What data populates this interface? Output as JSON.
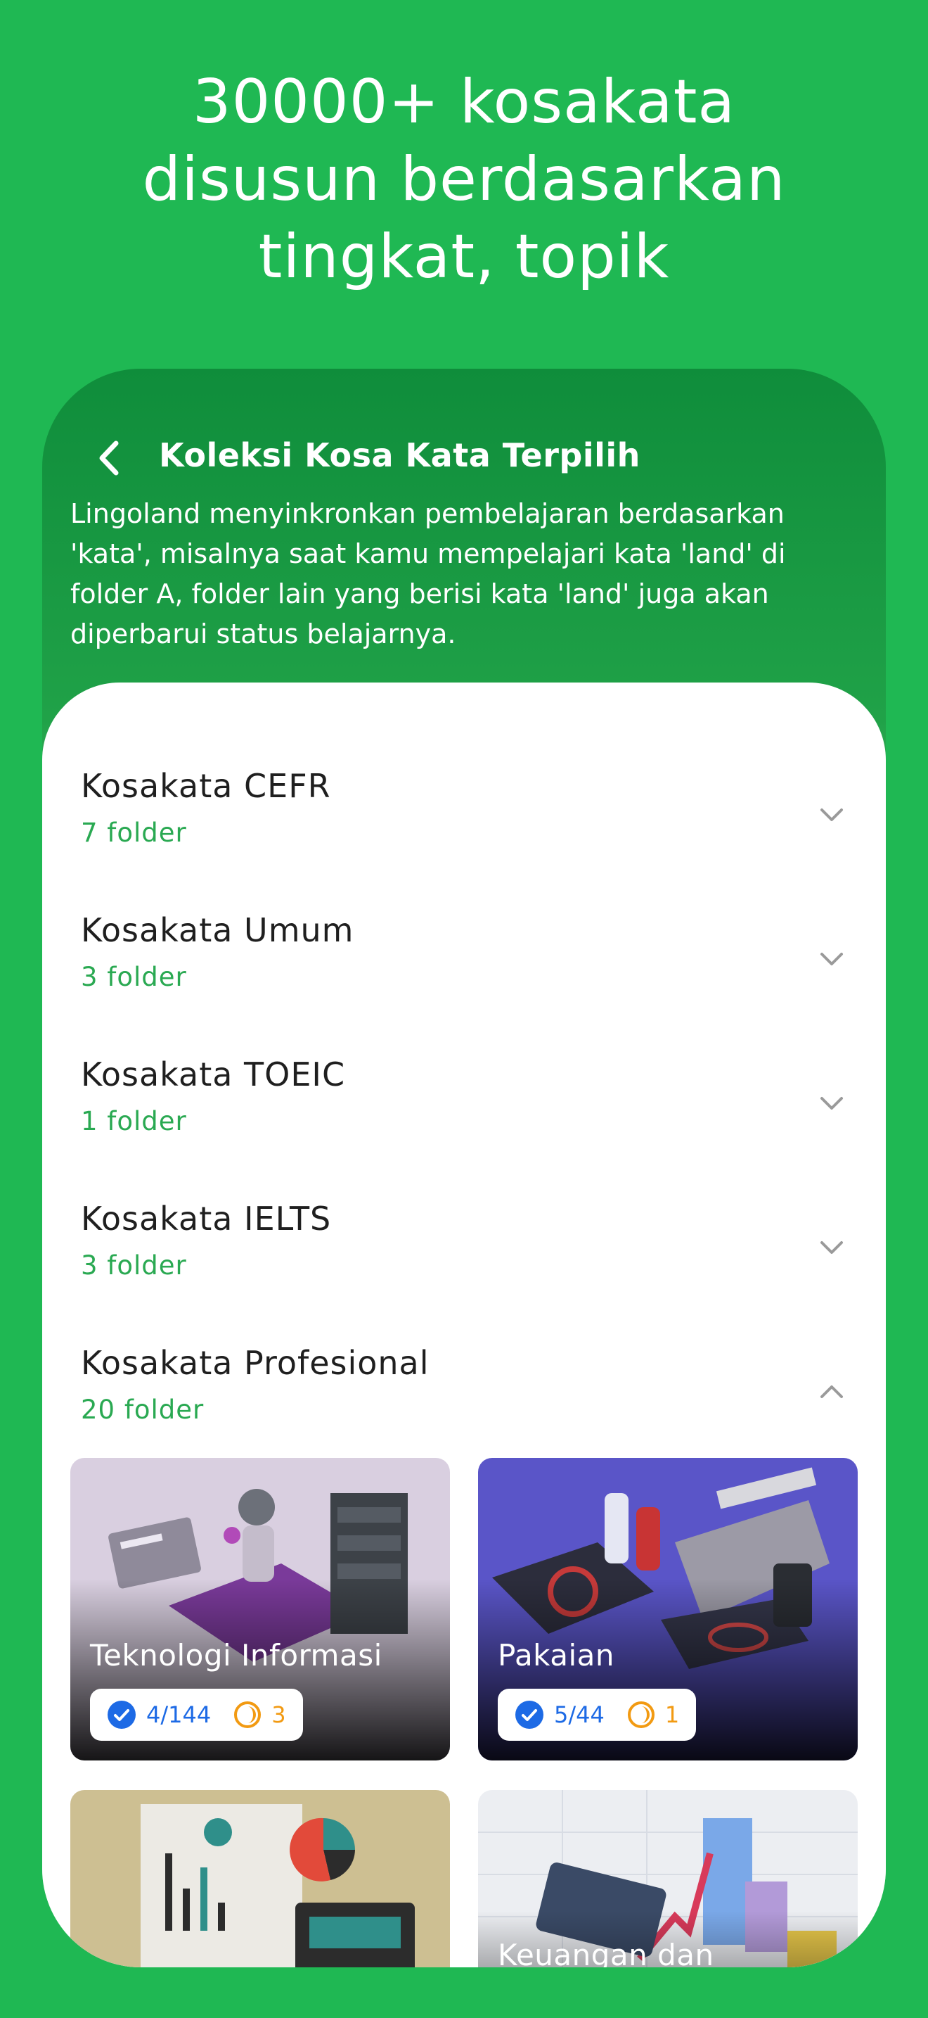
{
  "headline": {
    "line1": "30000+ kosakata",
    "line2": "disusun berdasarkan",
    "line3": "tingkat, topik"
  },
  "screen": {
    "title": "Koleksi Kosa Kata Terpilih",
    "description": "Lingoland menyinkronkan pembelajaran berdasarkan 'kata', misalnya saat kamu mempelajari kata 'land' di folder A, folder lain yang berisi kata 'land' juga akan diperbarui status belajarnya."
  },
  "groups": [
    {
      "title": "Kosakata CEFR",
      "count": "7 folder",
      "expanded": false
    },
    {
      "title": "Kosakata Umum",
      "count": "3 folder",
      "expanded": false
    },
    {
      "title": "Kosakata TOEIC",
      "count": "1 folder",
      "expanded": false
    },
    {
      "title": "Kosakata IELTS",
      "count": "3 folder",
      "expanded": false
    },
    {
      "title": "Kosakata Profesional",
      "count": "20 folder",
      "expanded": true
    }
  ],
  "tiles": [
    {
      "title": "Teknologi Informasi",
      "learned": "4/144",
      "in_progress": "3"
    },
    {
      "title": "Pakaian",
      "learned": "5/44",
      "in_progress": "1"
    },
    {
      "title": "",
      "learned": "",
      "in_progress": ""
    },
    {
      "title": "Keuangan dan",
      "learned": "",
      "in_progress": ""
    }
  ],
  "colors": {
    "brand_green": "#1fb853",
    "count_green": "#2aa952",
    "check_blue": "#1d6ae5",
    "progress_orange": "#f29a12"
  },
  "icons": {
    "back": "back-arrow-icon",
    "collapsed": "chevron-down-icon",
    "expanded": "chevron-up-icon",
    "learned": "check-circle-icon",
    "in_progress": "half-moon-progress-icon"
  }
}
